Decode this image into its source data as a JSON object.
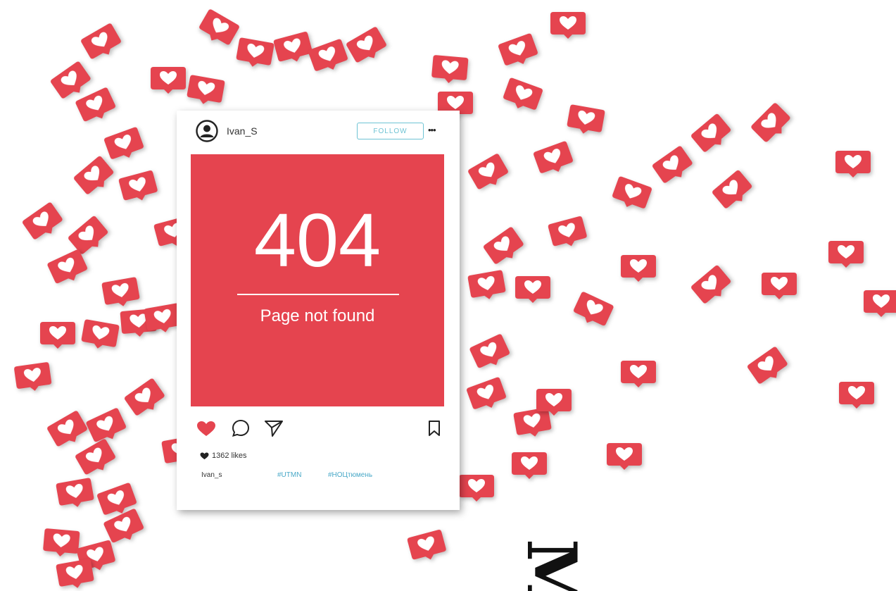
{
  "post": {
    "username": "Ivan_S",
    "follow_label": "FOLLOW",
    "more_label": "•••",
    "error_code": "404",
    "error_message": "Page not found",
    "likes_count": "1362 likes",
    "caption_user": "Ivan_s",
    "hashtags": [
      "#UTMN",
      "#НОЦтюмень"
    ]
  },
  "icons": {
    "avatar": "user-avatar-icon",
    "more": "more-options-icon",
    "like": "heart-icon",
    "comment": "comment-icon",
    "share": "send-icon",
    "save": "bookmark-icon",
    "badge": "heart-notification-icon"
  },
  "bottom_glyph": "M",
  "colors": {
    "brand_red": "#e5444f",
    "follow_border": "#6ec3d4",
    "hashtag": "#4aa9c8",
    "background": "#ffffff"
  }
}
